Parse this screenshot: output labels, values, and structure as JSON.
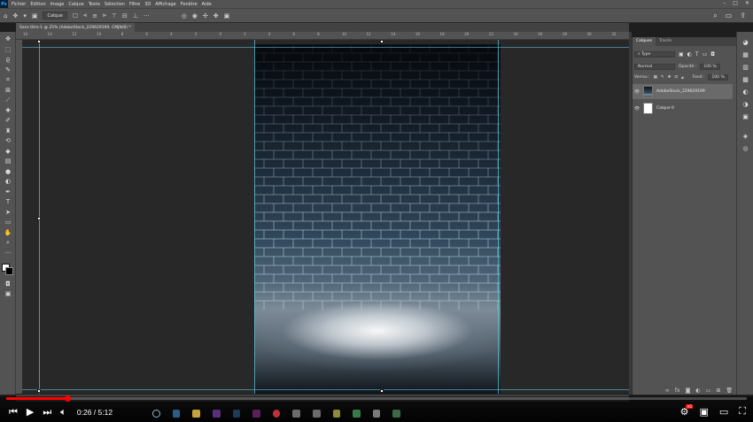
{
  "menu": {
    "app_icon": "Ps",
    "items": [
      "Fichier",
      "Edition",
      "Image",
      "Calque",
      "Texte",
      "Sélection",
      "Filtre",
      "3D",
      "Affichage",
      "Fenêtre",
      "Aide"
    ],
    "window_controls": [
      "–",
      "□",
      "✕"
    ]
  },
  "options": {
    "select_label": "Calque"
  },
  "document": {
    "tab_title": "Sans titre-1 @ 25% (AdobeStock_229629199, CMJN/8) *",
    "ruler_ticks": [
      "16",
      "14",
      "12",
      "10",
      "8",
      "6",
      "4",
      "2",
      "0",
      "2",
      "4",
      "6",
      "8",
      "10",
      "12",
      "14",
      "16",
      "18",
      "20",
      "22",
      "24",
      "26",
      "28",
      "30",
      "32"
    ]
  },
  "layers_panel": {
    "tabs": [
      "Calques",
      "Tracés"
    ],
    "filter_label": "Type",
    "blend_mode": "Normal",
    "opacity_label": "Opacité :",
    "opacity_value": "100 %",
    "lock_label": "Verrou :",
    "fill_label": "Fond :",
    "fill_value": "100 %",
    "layers": [
      {
        "name": "AdobeStock_229629199",
        "visible": true,
        "selected": true
      },
      {
        "name": "Calque 0",
        "visible": true,
        "selected": false
      }
    ]
  },
  "player": {
    "time_current": "0:26",
    "time_separator": " / ",
    "time_total": "5:12",
    "progress_fraction": 0.083,
    "accent_color": "#ff0000",
    "hd_badge": "HD"
  },
  "icons": {
    "toolbar": [
      "move-icon",
      "marquee-icon",
      "lasso-icon",
      "quick-select-icon",
      "crop-icon",
      "frame-icon",
      "eyedropper-icon",
      "heal-icon",
      "brush-icon",
      "stamp-icon",
      "history-brush-icon",
      "eraser-icon",
      "gradient-icon",
      "blur-icon",
      "dodge-icon",
      "pen-icon",
      "type-icon",
      "path-select-icon",
      "shape-icon",
      "hand-icon",
      "zoom-icon",
      "more-icon"
    ]
  }
}
